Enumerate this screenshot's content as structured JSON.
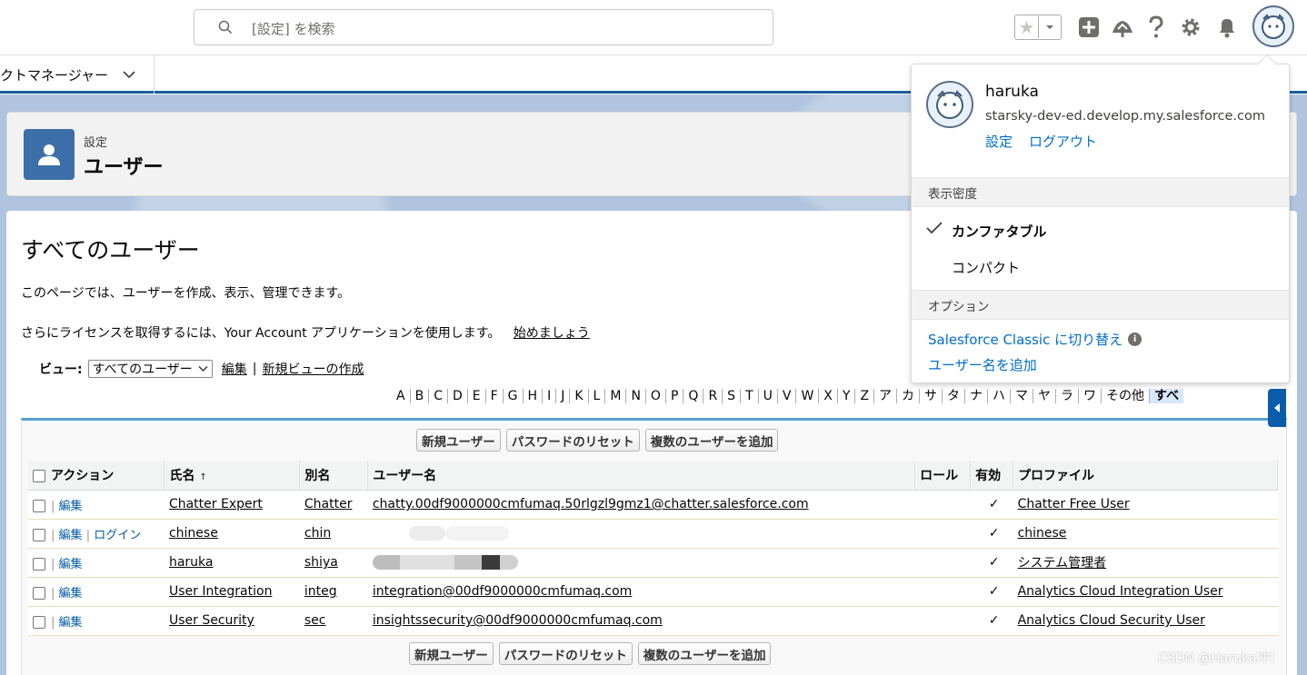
{
  "header": {
    "search_placeholder": "[設定] を検索"
  },
  "nav": {
    "app_name": "クトマネージャー"
  },
  "setup": {
    "breadcrumb": "設定",
    "title": "ユーザー"
  },
  "page": {
    "heading": "すべてのユーザー",
    "description": "このページでは、ユーザーを作成、表示、管理できます。",
    "license_text": "さらにライセンスを取得するには、Your Account アプリケーションを使用します。",
    "license_link": "始めましょう",
    "view_label": "ビュー:",
    "view_selected": "すべてのユーザー",
    "edit_link": "編集",
    "new_view_link": "新規ビューの作成",
    "separator": "|"
  },
  "alphabet": [
    "A",
    "B",
    "C",
    "D",
    "E",
    "F",
    "G",
    "H",
    "I",
    "J",
    "K",
    "L",
    "M",
    "N",
    "O",
    "P",
    "Q",
    "R",
    "S",
    "T",
    "U",
    "V",
    "W",
    "X",
    "Y",
    "Z",
    "ア",
    "カ",
    "サ",
    "タ",
    "ナ",
    "ハ",
    "マ",
    "ヤ",
    "ラ",
    "ワ",
    "その他",
    "すべ"
  ],
  "buttons": {
    "new_user": "新規ユーザー",
    "reset_password": "パスワードのリセット",
    "add_multiple": "複数のユーザーを追加"
  },
  "table": {
    "columns": {
      "action": "アクション",
      "name": "氏名",
      "sort_arrow": "↑",
      "alias": "別名",
      "username": "ユーザー名",
      "role": "ロール",
      "active": "有効",
      "profile": "プロファイル"
    },
    "action_edit": "編集",
    "action_login": "ログイン",
    "check_mark": "✓",
    "rows": [
      {
        "name": "Chatter Expert",
        "alias": "Chatter",
        "username": "chatty.00df9000000cmfumaq.50rlgzl9gmz1@chatter.salesforce.com",
        "profile": "Chatter Free User"
      },
      {
        "name": "chinese",
        "alias": "chin",
        "username": "",
        "profile": "chinese"
      },
      {
        "name": "haruka",
        "alias": "shiya",
        "username": "",
        "profile": "システム管理者"
      },
      {
        "name": "User Integration",
        "alias": "integ",
        "username": "integration@00df9000000cmfumaq.com",
        "profile": "Analytics Cloud Integration User"
      },
      {
        "name": "User Security",
        "alias": "sec",
        "username": "insightssecurity@00df9000000cmfumaq.com",
        "profile": "Analytics Cloud Security User"
      }
    ]
  },
  "user_panel": {
    "name": "haruka",
    "org": "starsky-dev-ed.develop.my.salesforce.com",
    "settings_link": "設定",
    "logout_link": "ログアウト",
    "density_header": "表示密度",
    "density_comfortable": "カンファタブル",
    "density_compact": "コンパクト",
    "options_header": "オプション",
    "switch_classic": "Salesforce Classic に切り替え",
    "add_username": "ユーザー名を追加",
    "info_glyph": "i"
  },
  "watermark": "CSDN @Haruka冲！"
}
